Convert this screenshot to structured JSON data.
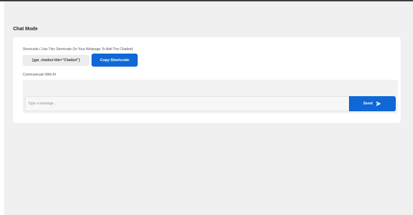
{
  "page": {
    "title": "Chat Mode"
  },
  "shortcode": {
    "label": "Shortcode ( Use This Shortcode On Your Webpage To Add The Chatbot)",
    "value": "[gpt_chatbot title=\"Chatbot\"]",
    "copy_button_label": "Copy Shortcode"
  },
  "chat": {
    "label": "Communicate With AI",
    "input_placeholder": "Type a message...",
    "input_value": "",
    "send_button_label": "Send",
    "send_icon": "paper-plane-icon"
  },
  "colors": {
    "accent": "#1067d6",
    "background": "#f0f0f1",
    "card": "#ffffff"
  }
}
